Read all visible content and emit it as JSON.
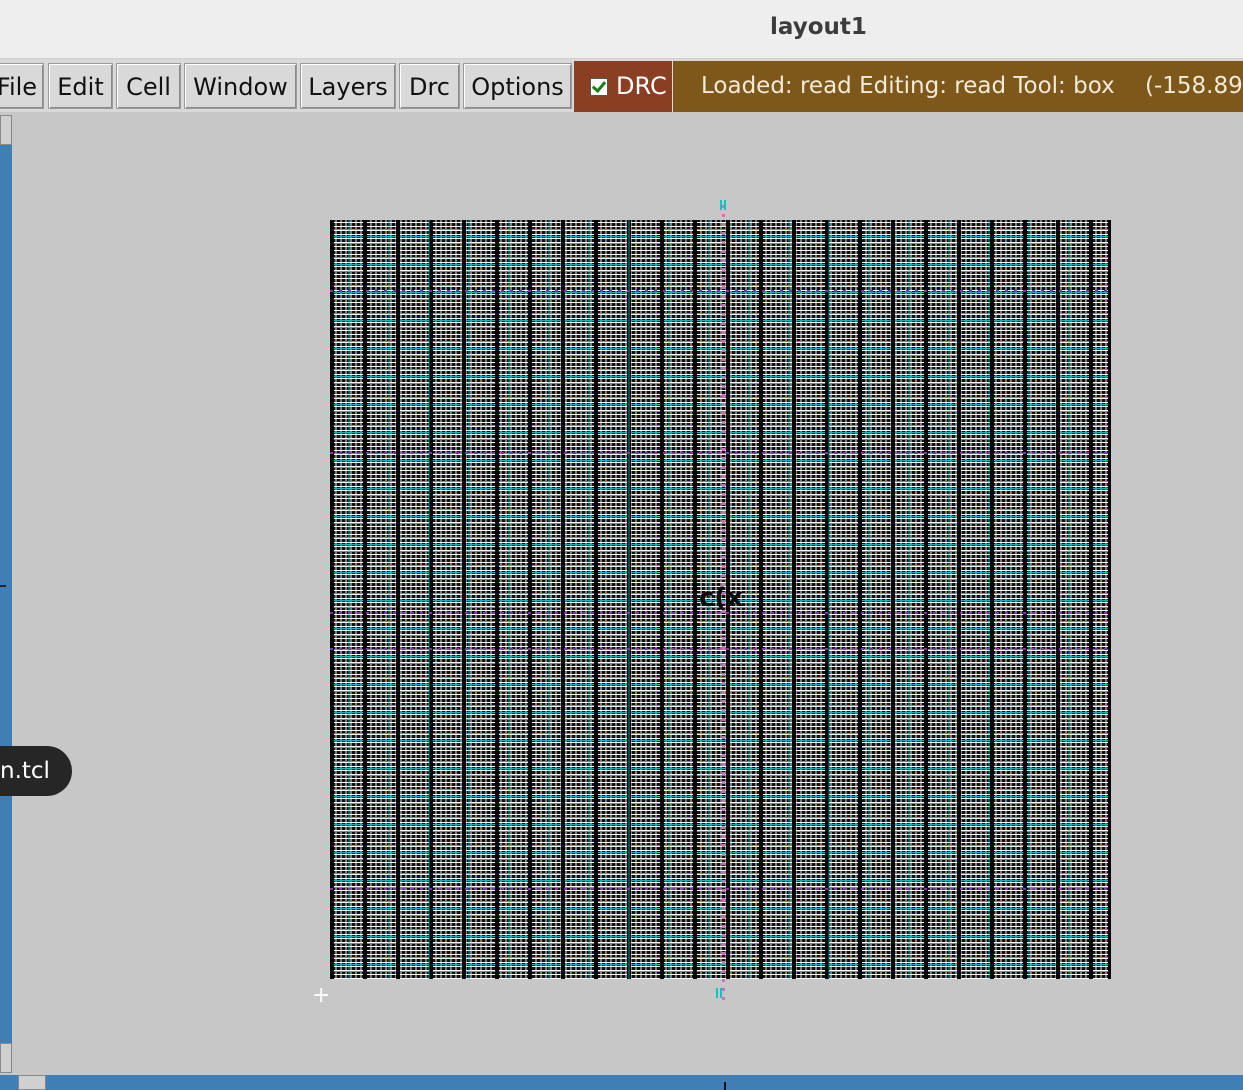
{
  "window": {
    "title": "layout1"
  },
  "menu": {
    "items": [
      "File",
      "Edit",
      "Cell",
      "Window",
      "Layers",
      "Drc",
      "Options"
    ]
  },
  "drc_toggle": {
    "label": "DRC",
    "checked": true
  },
  "status": {
    "text": "Loaded: read Editing: read Tool: box",
    "coords": "(-158.89"
  },
  "tooltip": {
    "text": "n.tcl"
  },
  "colors": {
    "canvas_bg": "#c7c7c7",
    "drc_bg": "#8a3e22",
    "status_bg": "#7e571b",
    "scrollbar": "#3f7fb5",
    "metal_cyan": "#00b8b8",
    "via_purple": "#8a2bb5"
  },
  "icons": [
    "checkbox-icon",
    "crosshair-icon",
    "scroll-up-arrow-icon",
    "scroll-down-arrow-icon",
    "scroll-left-arrow-icon"
  ]
}
